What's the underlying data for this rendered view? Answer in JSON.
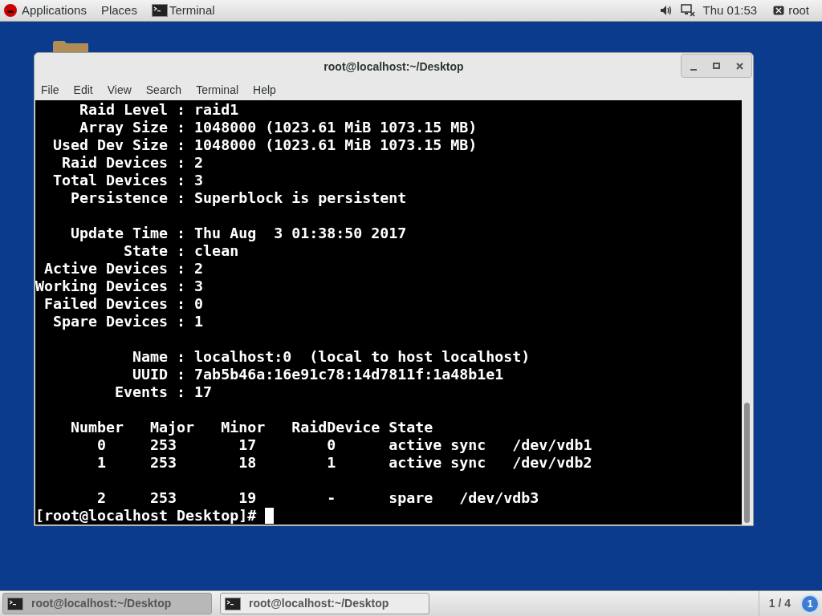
{
  "top_bar": {
    "menus": [
      "Applications",
      "Places"
    ],
    "app": "Terminal",
    "clock": "Thu 01:53",
    "user": "root"
  },
  "window": {
    "title": "root@localhost:~/Desktop",
    "menu": [
      "File",
      "Edit",
      "View",
      "Search",
      "Terminal",
      "Help"
    ],
    "terminal": {
      "blocks": [
        [
          "     Raid Level : raid1",
          "     Array Size : 1048000 (1023.61 MiB 1073.15 MB)",
          "  Used Dev Size : 1048000 (1023.61 MiB 1073.15 MB)",
          "   Raid Devices : 2",
          "  Total Devices : 3",
          "    Persistence : Superblock is persistent"
        ],
        [
          "    Update Time : Thu Aug  3 01:38:50 2017",
          "          State : clean",
          " Active Devices : 2",
          "Working Devices : 3",
          " Failed Devices : 0",
          "  Spare Devices : 1"
        ],
        [
          "           Name : localhost:0  (local to host localhost)",
          "           UUID : 7ab5b46a:16e91c78:14d7811f:1a48b1e1",
          "         Events : 17"
        ],
        [
          "    Number   Major   Minor   RaidDevice State",
          "       0     253       17        0      active sync   /dev/vdb1",
          "       1     253       18        1      active sync   /dev/vdb2"
        ],
        [
          "       2     253       19        -      spare   /dev/vdb3"
        ]
      ],
      "prompt": "[root@localhost Desktop]# "
    }
  },
  "taskbar": {
    "tasks": [
      {
        "label": "root@localhost:~/Desktop",
        "selected": true
      },
      {
        "label": "root@localhost:~/Desktop",
        "selected": false
      }
    ],
    "workspace": "1 / 4",
    "badge": "1"
  }
}
